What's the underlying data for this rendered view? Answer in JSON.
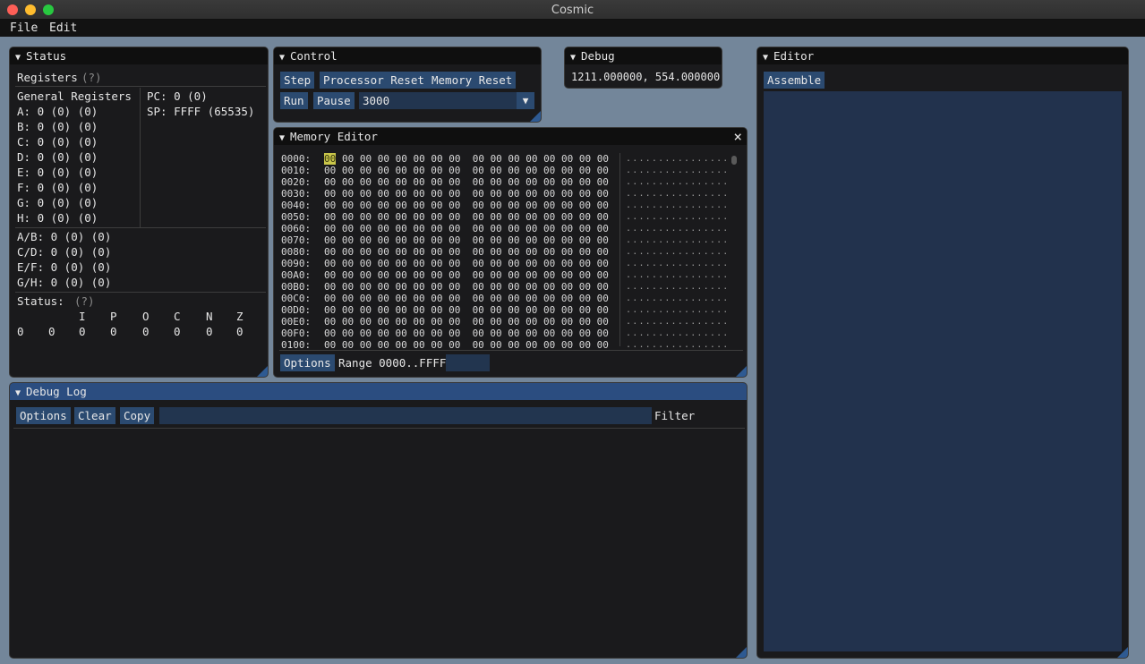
{
  "app": {
    "title": "Cosmic"
  },
  "menu": {
    "file": "File",
    "edit": "Edit"
  },
  "status": {
    "title": "Status",
    "registers_label": "Registers",
    "help": "(?)",
    "general_label": "General Registers",
    "general": [
      "A: 0 (0) (0)",
      "B: 0 (0) (0)",
      "C: 0 (0) (0)",
      "D: 0 (0) (0)",
      "E: 0 (0) (0)",
      "F: 0 (0) (0)",
      "G: 0 (0) (0)",
      "H: 0 (0) (0)"
    ],
    "pc": "PC: 0 (0)",
    "sp": "SP: FFFF (65535)",
    "pairs": [
      "A/B: 0 (0) (0)",
      "C/D: 0 (0) (0)",
      "E/F: 0 (0) (0)",
      "G/H: 0 (0) (0)"
    ],
    "flags_label": "Status:",
    "flags_help": "(?)",
    "flag_names": [
      "I",
      "P",
      "O",
      "C",
      "N",
      "Z"
    ],
    "flag_values": [
      "0",
      "0",
      "0",
      "0",
      "0",
      "0",
      "0",
      "0"
    ]
  },
  "control": {
    "title": "Control",
    "step": "Step",
    "processor_reset": "Processor Reset",
    "memory_reset": "Memory Reset",
    "run": "Run",
    "pause": "Pause",
    "speed_value": "3000"
  },
  "debug": {
    "title": "Debug",
    "value": "1211.000000, 554.000000"
  },
  "editor": {
    "title": "Editor",
    "assemble": "Assemble"
  },
  "memory": {
    "title": "Memory Editor",
    "close": "×",
    "addresses": [
      "0000:",
      "0010:",
      "0020:",
      "0030:",
      "0040:",
      "0050:",
      "0060:",
      "0070:",
      "0080:",
      "0090:",
      "00A0:",
      "00B0:",
      "00C0:",
      "00D0:",
      "00E0:",
      "00F0:",
      "0100:"
    ],
    "bytes_first": "00",
    "bytes_rest": "00 00 00 00 00 00 00  00 00 00 00 00 00 00 00",
    "bytes_full": "00 00 00 00 00 00 00 00  00 00 00 00 00 00 00 00",
    "ascii": "................",
    "options": "Options",
    "range": "Range 0000..FFFF"
  },
  "debuglog": {
    "title": "Debug Log",
    "options": "Options",
    "clear": "Clear",
    "copy": "Copy",
    "filter_label": "Filter",
    "filter_value": ""
  },
  "colors": {
    "accent": "#2b4a70",
    "desktop": "#73869a",
    "highlight": "#c9c64a"
  }
}
